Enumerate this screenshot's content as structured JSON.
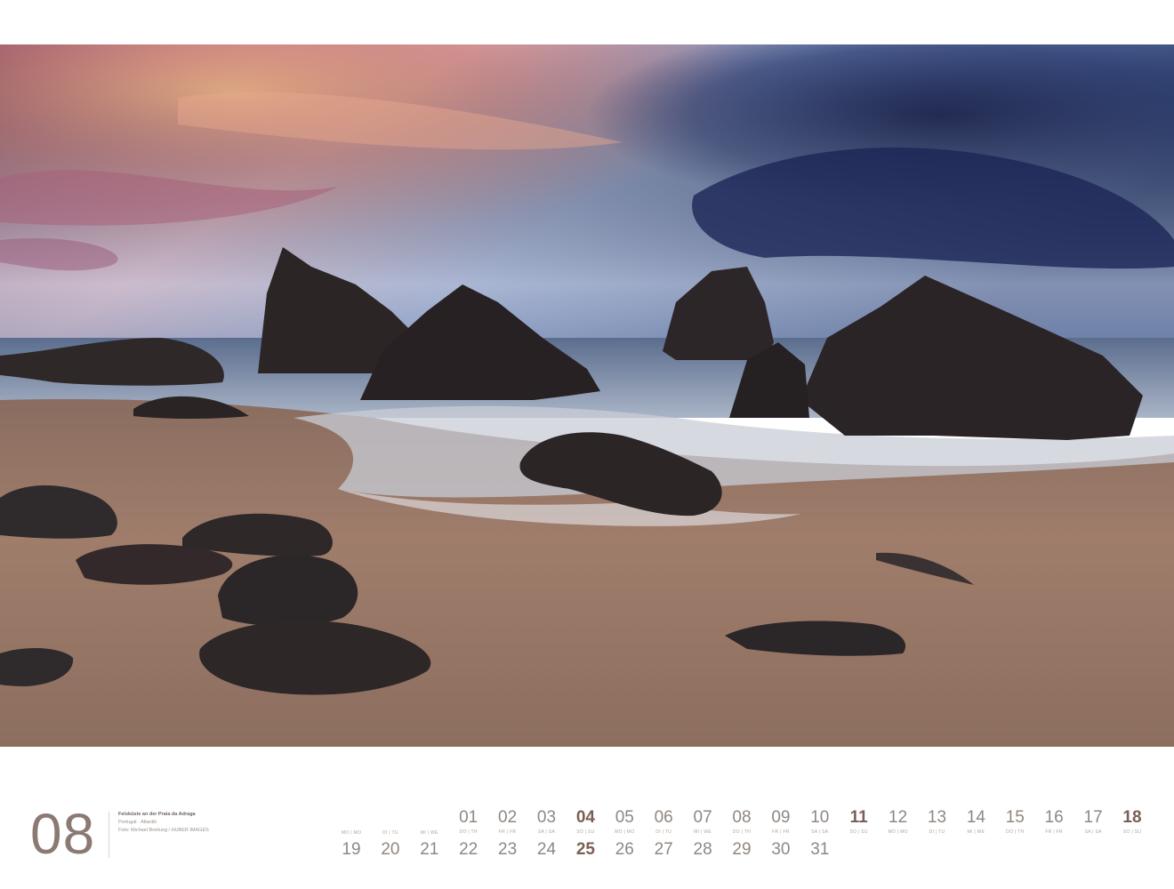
{
  "month": {
    "number": "08"
  },
  "caption": {
    "title": "Felsküste an der Praia da Adraga",
    "location": "Portugal · Atlantik",
    "credit": "Foto: Michael Breitung / HUBER IMAGES"
  },
  "calendar": {
    "top_row": [
      {
        "num": "01",
        "name": "DO | TH",
        "sunday": false
      },
      {
        "num": "02",
        "name": "FR | FR",
        "sunday": false
      },
      {
        "num": "03",
        "name": "SA | SA",
        "sunday": false
      },
      {
        "num": "04",
        "name": "SO | SU",
        "sunday": true
      },
      {
        "num": "05",
        "name": "MO | MO",
        "sunday": false
      },
      {
        "num": "06",
        "name": "DI | TU",
        "sunday": false
      },
      {
        "num": "07",
        "name": "MI | WE",
        "sunday": false
      },
      {
        "num": "08",
        "name": "DO | TH",
        "sunday": false
      },
      {
        "num": "09",
        "name": "FR | FR",
        "sunday": false
      },
      {
        "num": "10",
        "name": "SA | SA",
        "sunday": false
      },
      {
        "num": "11",
        "name": "SO | SU",
        "sunday": true
      },
      {
        "num": "12",
        "name": "MO | MO",
        "sunday": false
      },
      {
        "num": "13",
        "name": "DI | TU",
        "sunday": false
      },
      {
        "num": "14",
        "name": "MI | WE",
        "sunday": false
      },
      {
        "num": "15",
        "name": "DO | TH",
        "sunday": false
      },
      {
        "num": "16",
        "name": "FR | FR",
        "sunday": false
      },
      {
        "num": "17",
        "name": "SA | SA",
        "sunday": false
      },
      {
        "num": "18",
        "name": "SO | SU",
        "sunday": true
      }
    ],
    "bottom_row": [
      {
        "num": "19",
        "name": "MO | MO",
        "sunday": false
      },
      {
        "num": "20",
        "name": "DI | TU",
        "sunday": false
      },
      {
        "num": "21",
        "name": "MI | WE",
        "sunday": false
      },
      {
        "num": "22",
        "sunday": false
      },
      {
        "num": "23",
        "sunday": false
      },
      {
        "num": "24",
        "sunday": false
      },
      {
        "num": "25",
        "sunday": true
      },
      {
        "num": "26",
        "sunday": false
      },
      {
        "num": "27",
        "sunday": false
      },
      {
        "num": "28",
        "sunday": false
      },
      {
        "num": "29",
        "sunday": false
      },
      {
        "num": "30",
        "sunday": false
      },
      {
        "num": "31",
        "sunday": false
      }
    ]
  },
  "colors": {
    "month_number": "#8a7a72",
    "sunday": "#7a5f55",
    "weekday": "#8f8781"
  }
}
